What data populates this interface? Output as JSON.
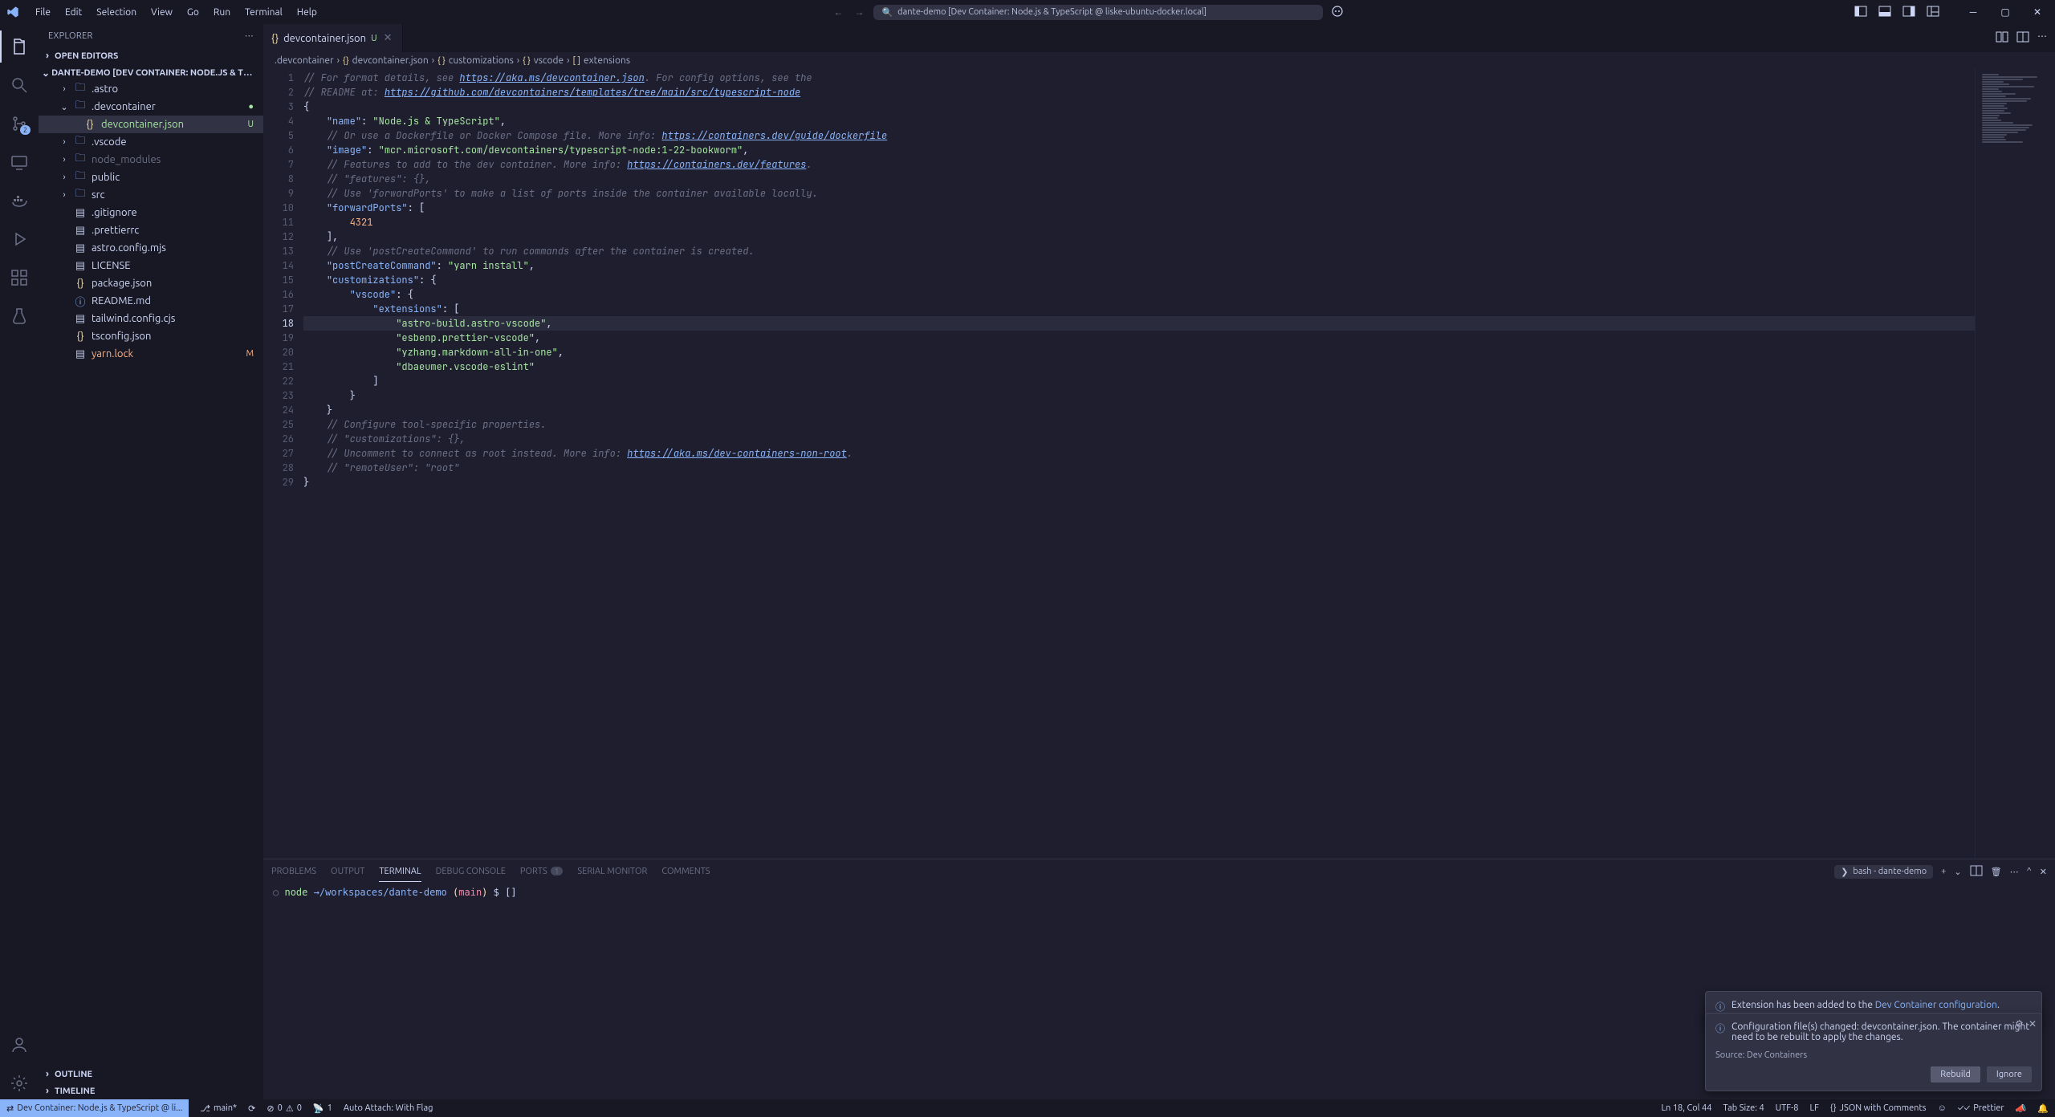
{
  "menu": [
    "File",
    "Edit",
    "Selection",
    "View",
    "Go",
    "Run",
    "Terminal",
    "Help"
  ],
  "title_search": "dante-demo [Dev Container: Node.js & TypeScript @ liske-ubuntu-docker.local]",
  "sidebar": {
    "title": "EXPLORER",
    "sections": {
      "open_editors": "OPEN EDITORS",
      "workspace": "DANTE-DEMO [DEV CONTAINER: NODE.JS & TYPESCRIPT @ LISKE-UBUNTU-DOCKER...",
      "outline": "OUTLINE",
      "timeline": "TIMELINE"
    },
    "tree": [
      {
        "type": "folder",
        "name": ".astro",
        "depth": 1,
        "expanded": false
      },
      {
        "type": "folder",
        "name": ".devcontainer",
        "depth": 1,
        "expanded": true,
        "decor": "●",
        "decorClass": "u"
      },
      {
        "type": "file",
        "name": "devcontainer.json",
        "depth": 2,
        "active": true,
        "fileClass": "file-json",
        "decor": "U",
        "decorClass": "u"
      },
      {
        "type": "folder",
        "name": ".vscode",
        "depth": 1,
        "expanded": false
      },
      {
        "type": "folder",
        "name": "node_modules",
        "depth": 1,
        "expanded": false,
        "dim": true
      },
      {
        "type": "folder",
        "name": "public",
        "depth": 1,
        "expanded": false
      },
      {
        "type": "folder",
        "name": "src",
        "depth": 1,
        "expanded": false
      },
      {
        "type": "file",
        "name": ".gitignore",
        "depth": 1,
        "fileClass": "file-misc"
      },
      {
        "type": "file",
        "name": ".prettierrc",
        "depth": 1,
        "fileClass": "file-misc"
      },
      {
        "type": "file",
        "name": "astro.config.mjs",
        "depth": 1,
        "fileClass": "file-misc"
      },
      {
        "type": "file",
        "name": "LICENSE",
        "depth": 1,
        "fileClass": "file-misc"
      },
      {
        "type": "file",
        "name": "package.json",
        "depth": 1,
        "fileClass": "file-json"
      },
      {
        "type": "file",
        "name": "README.md",
        "depth": 1,
        "fileClass": "file-md"
      },
      {
        "type": "file",
        "name": "tailwind.config.cjs",
        "depth": 1,
        "fileClass": "file-misc"
      },
      {
        "type": "file",
        "name": "tsconfig.json",
        "depth": 1,
        "fileClass": "file-json"
      },
      {
        "type": "file",
        "name": "yarn.lock",
        "depth": 1,
        "fileClass": "file-misc",
        "decor": "M",
        "decorClass": "m"
      }
    ]
  },
  "tab": {
    "label": "devcontainer.json",
    "mod": "U"
  },
  "breadcrumbs": [
    {
      "icon": "",
      "label": ".devcontainer"
    },
    {
      "icon": "{}",
      "label": "devcontainer.json"
    },
    {
      "icon": "{ }",
      "label": "customizations"
    },
    {
      "icon": "{ }",
      "label": "vscode"
    },
    {
      "icon": "[ ]",
      "label": "extensions"
    }
  ],
  "code": {
    "lines": [
      {
        "n": 1,
        "html": "<span class='tok-comment'>// For format details, see <span class='tok-link'>https://aka.ms/devcontainer.json</span>. For config options, see the</span>"
      },
      {
        "n": 2,
        "html": "<span class='tok-comment'>// README at: <span class='tok-link'>https://github.com/devcontainers/templates/tree/main/src/typescript-node</span></span>"
      },
      {
        "n": 3,
        "html": "<span class='tok-punc'>{</span>"
      },
      {
        "n": 4,
        "html": "    <span class='tok-key'>\"name\"</span><span class='tok-punc'>:</span> <span class='tok-str'>\"Node.js &amp; TypeScript\"</span><span class='tok-punc'>,</span>"
      },
      {
        "n": 5,
        "html": "    <span class='tok-comment'>// Or use a Dockerfile or Docker Compose file. More info: <span class='tok-link'>https://containers.dev/guide/dockerfile</span></span>"
      },
      {
        "n": 6,
        "html": "    <span class='tok-key'>\"image\"</span><span class='tok-punc'>:</span> <span class='tok-str'>\"mcr.microsoft.com/devcontainers/typescript-node:1-22-bookworm\"</span><span class='tok-punc'>,</span>"
      },
      {
        "n": 7,
        "html": "    <span class='tok-comment'>// Features to add to the dev container. More info: <span class='tok-link'>https://containers.dev/features</span>.</span>"
      },
      {
        "n": 8,
        "html": "    <span class='tok-comment'>// \"features\": {},</span>"
      },
      {
        "n": 9,
        "html": "    <span class='tok-comment'>// Use 'forwardPorts' to make a list of ports inside the container available locally.</span>"
      },
      {
        "n": 10,
        "html": "    <span class='tok-key'>\"forwardPorts\"</span><span class='tok-punc'>:</span> <span class='tok-punc'>[</span>"
      },
      {
        "n": 11,
        "html": "        <span class='tok-num'>4321</span>"
      },
      {
        "n": 12,
        "html": "    <span class='tok-punc'>],</span>"
      },
      {
        "n": 13,
        "html": "    <span class='tok-comment'>// Use 'postCreateCommand' to run commands after the container is created.</span>"
      },
      {
        "n": 14,
        "html": "    <span class='tok-key'>\"postCreateCommand\"</span><span class='tok-punc'>:</span> <span class='tok-str'>\"yarn install\"</span><span class='tok-punc'>,</span>"
      },
      {
        "n": 15,
        "html": "    <span class='tok-key'>\"customizations\"</span><span class='tok-punc'>:</span> <span class='tok-punc'>{</span>"
      },
      {
        "n": 16,
        "html": "        <span class='tok-key'>\"vscode\"</span><span class='tok-punc'>:</span> <span class='tok-punc'>{</span>"
      },
      {
        "n": 17,
        "html": "            <span class='tok-key'>\"extensions\"</span><span class='tok-punc'>:</span> <span class='tok-punc'>[</span>"
      },
      {
        "n": 18,
        "html": "                <span class='tok-str'>\"astro-build.astro-vscode\"</span><span class='tok-punc'>,</span>",
        "current": true
      },
      {
        "n": 19,
        "html": "                <span class='tok-str'>\"esbenp.prettier-vscode\"</span><span class='tok-punc'>,</span>"
      },
      {
        "n": 20,
        "html": "                <span class='tok-str'>\"yzhang.markdown-all-in-one\"</span><span class='tok-punc'>,</span>"
      },
      {
        "n": 21,
        "html": "                <span class='tok-str'>\"dbaeumer.vscode-eslint\"</span>"
      },
      {
        "n": 22,
        "html": "            <span class='tok-punc'>]</span>"
      },
      {
        "n": 23,
        "html": "        <span class='tok-punc'>}</span>"
      },
      {
        "n": 24,
        "html": "    <span class='tok-punc'>}</span>"
      },
      {
        "n": 25,
        "html": "    <span class='tok-comment'>// Configure tool-specific properties.</span>"
      },
      {
        "n": 26,
        "html": "    <span class='tok-comment'>// \"customizations\": {},</span>"
      },
      {
        "n": 27,
        "html": "    <span class='tok-comment'>// Uncomment to connect as root instead. More info: <span class='tok-link'>https://aka.ms/dev-containers-non-root</span>.</span>"
      },
      {
        "n": 28,
        "html": "    <span class='tok-comment'>// \"remoteUser\": \"root\"</span>"
      },
      {
        "n": 29,
        "html": "<span class='tok-punc'>}</span>"
      }
    ]
  },
  "panel": {
    "tabs": [
      {
        "label": "PROBLEMS"
      },
      {
        "label": "OUTPUT"
      },
      {
        "label": "TERMINAL",
        "active": true
      },
      {
        "label": "DEBUG CONSOLE"
      },
      {
        "label": "PORTS",
        "count": "1"
      },
      {
        "label": "SERIAL MONITOR"
      },
      {
        "label": "COMMENTS"
      }
    ],
    "terminal_label": "bash - dante-demo",
    "prompt": {
      "circ": "○",
      "node": "node",
      "arrow": "→",
      "path": "/workspaces/dante-demo",
      "branch_open": "(",
      "branch": "main",
      "branch_close": ")",
      "dollar": "$",
      "cursor": "[]"
    }
  },
  "toast1": {
    "text_pre": "Extension has been added to the ",
    "link": "Dev Container configuration",
    "text_post": "."
  },
  "toast2": {
    "text": "Configuration file(s) changed: devcontainer.json. The container might need to be rebuilt to apply the changes.",
    "source": "Source: Dev Containers",
    "btn_primary": "Rebuild",
    "btn_secondary": "Ignore"
  },
  "status": {
    "remote": "Dev Container: Node.js & TypeScript @ li...",
    "branch": "main*",
    "errors": "0",
    "warnings": "0",
    "ports": "1",
    "auto_attach": "Auto Attach: With Flag",
    "ln_col": "Ln 18, Col 44",
    "tab_size": "Tab Size: 4",
    "encoding": "UTF-8",
    "eol": "LF",
    "lang": "JSON with Comments",
    "prettier": "Prettier"
  }
}
